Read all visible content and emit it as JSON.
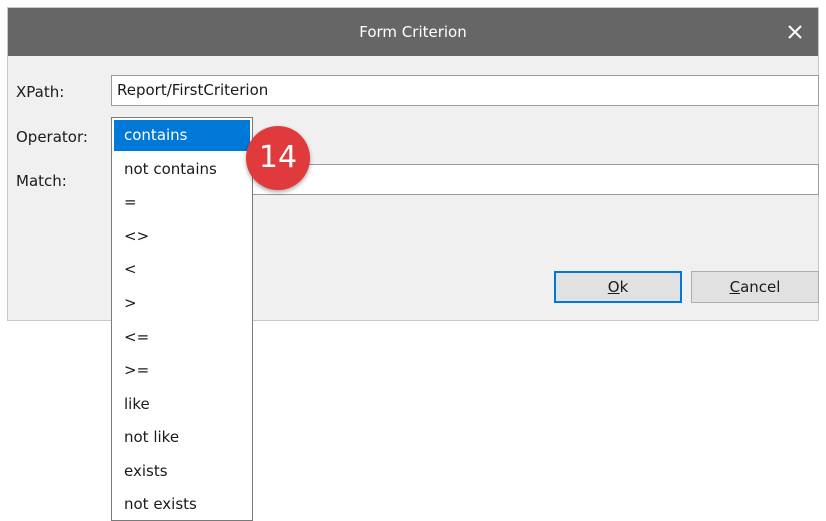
{
  "dialog": {
    "title": "Form Criterion",
    "close_glyph": "close-icon"
  },
  "form": {
    "xpath_label": "XPath:",
    "xpath_value": "Report/FirstCriterion",
    "operator_label": "Operator:",
    "match_label": "Match:",
    "match_value": ""
  },
  "buttons": {
    "ok_mnemonic": "O",
    "ok_rest": "k",
    "cancel_mnemonic": "C",
    "cancel_rest": "ancel"
  },
  "operator_options": [
    {
      "label": "contains",
      "selected": true
    },
    {
      "label": "not contains",
      "selected": false
    },
    {
      "label": "=",
      "selected": false
    },
    {
      "label": "<>",
      "selected": false
    },
    {
      "label": "<",
      "selected": false
    },
    {
      "label": ">",
      "selected": false
    },
    {
      "label": "<=",
      "selected": false
    },
    {
      "label": ">=",
      "selected": false
    },
    {
      "label": "like",
      "selected": false
    },
    {
      "label": "not like",
      "selected": false
    },
    {
      "label": "exists",
      "selected": false
    },
    {
      "label": "not exists",
      "selected": false
    }
  ],
  "callout": {
    "number": "14",
    "color": "#e03a3c"
  },
  "colors": {
    "titlebar": "#666666",
    "selection": "#0078d7"
  }
}
